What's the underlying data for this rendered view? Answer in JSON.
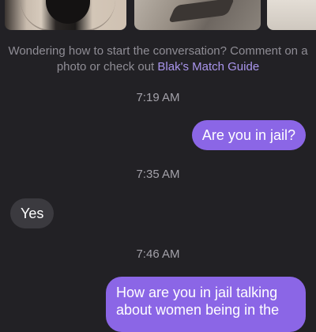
{
  "header": {
    "photos": [
      {
        "icon": "profile-photo-1"
      },
      {
        "icon": "profile-photo-2"
      },
      {
        "icon": "profile-photo-3"
      }
    ]
  },
  "prompt": {
    "text": "Wondering how to start the conversation? Comment on a photo or check out ",
    "link_label": "Blak's Match Guide"
  },
  "messages": [
    {
      "type": "timestamp",
      "text": "7:19 AM"
    },
    {
      "type": "sent",
      "text": "Are you in jail?"
    },
    {
      "type": "timestamp",
      "text": "7:35 AM"
    },
    {
      "type": "received",
      "text": "Yes"
    },
    {
      "type": "timestamp",
      "text": "7:46 AM"
    },
    {
      "type": "sent",
      "text": "How are you in jail talking about women being in the"
    }
  ],
  "colors": {
    "background": "#222125",
    "sent_bubble": "#8b66e6",
    "received_bubble": "#3b3a3f",
    "link": "#a995ec"
  }
}
